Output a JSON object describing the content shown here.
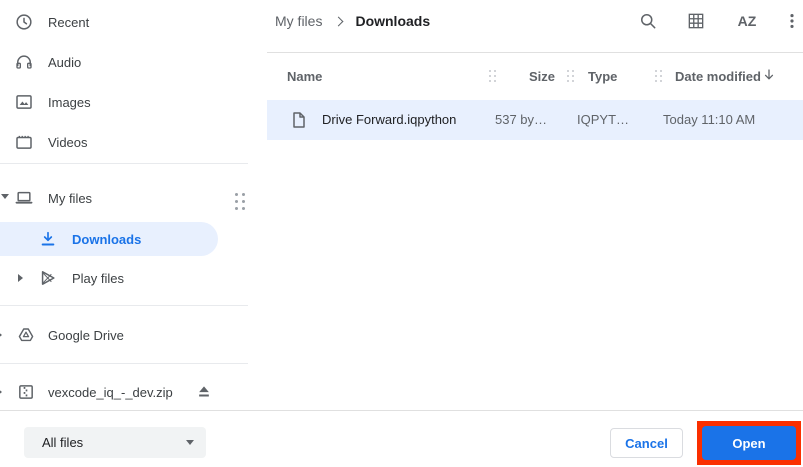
{
  "colors": {
    "accent": "#1a73e8",
    "selection_bg": "#e8f0fe",
    "annotation_red": "#fa2f00",
    "text_primary": "#202124",
    "text_secondary": "#5f6368"
  },
  "sidebar": {
    "items": [
      {
        "label": "Recent",
        "icon": "clock-icon"
      },
      {
        "label": "Audio",
        "icon": "headphones-icon"
      },
      {
        "label": "Images",
        "icon": "image-icon"
      },
      {
        "label": "Videos",
        "icon": "video-icon"
      },
      {
        "label": "My files",
        "icon": "laptop-icon",
        "expanded": true
      },
      {
        "label": "Downloads",
        "icon": "download-icon",
        "selected": true
      },
      {
        "label": "Play files",
        "icon": "play-icon",
        "collapsed": true
      },
      {
        "label": "Google Drive",
        "icon": "drive-icon",
        "collapsed": true
      },
      {
        "label": "vexcode_iq_-_dev.zip",
        "icon": "zip-icon",
        "ejectable": true,
        "collapsed": true
      }
    ]
  },
  "header": {
    "breadcrumb": [
      "My files",
      "Downloads"
    ],
    "sort_icon_label": "AZ",
    "actions": [
      "search-icon",
      "grid-view-icon",
      "sort-az-icon",
      "more-vert-icon"
    ]
  },
  "table": {
    "columns": [
      "Name",
      "Size",
      "Type",
      "Date modified"
    ],
    "sort": {
      "column": "Date modified",
      "direction": "desc"
    },
    "rows": [
      {
        "name": "Drive Forward.iqpython",
        "size": "537 by…",
        "type": "IQPYT…",
        "date_modified": "Today 11:10 AM",
        "selected": true,
        "icon": "file-icon"
      }
    ]
  },
  "footer": {
    "file_type_filter": "All files",
    "cancel_label": "Cancel",
    "open_label": "Open"
  }
}
